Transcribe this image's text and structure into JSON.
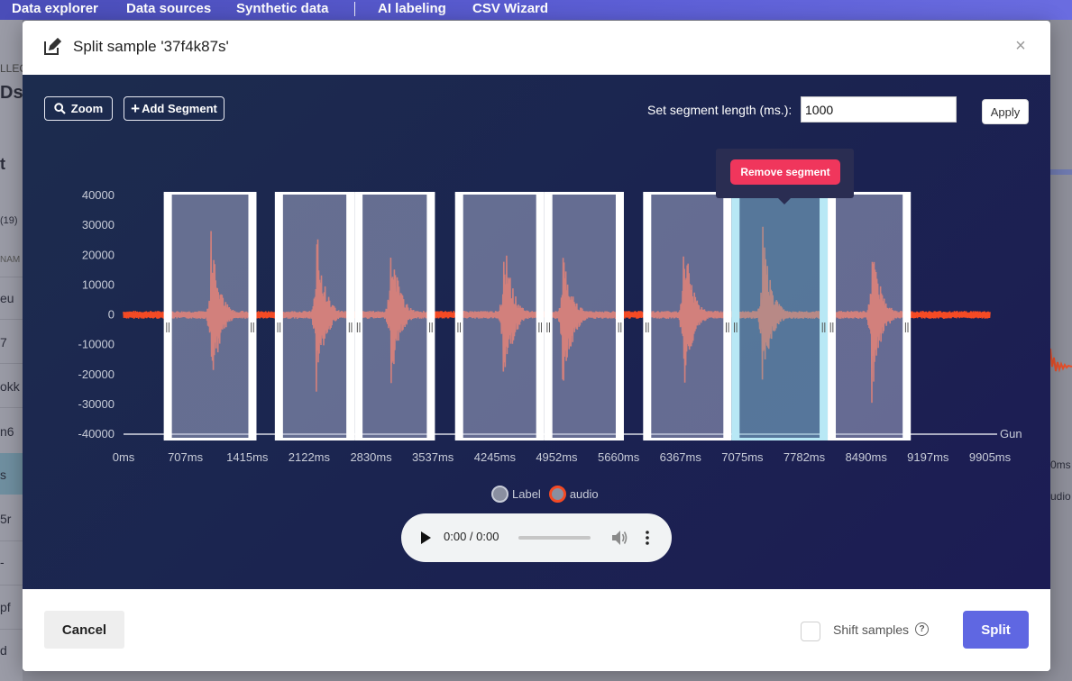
{
  "topnav": {
    "items": [
      "Data explorer",
      "Data sources",
      "Synthetic data",
      "AI labeling",
      "CSV Wizard"
    ]
  },
  "background_left": {
    "texts": [
      "LLEC",
      "Ds",
      "t",
      "(19)",
      "NAM",
      "eu",
      "7",
      "okk",
      "n6",
      "s",
      "5r",
      "-",
      "pf",
      "d"
    ]
  },
  "background_right": {
    "texts": [
      "0ms",
      "udio"
    ]
  },
  "modal": {
    "title": "Split sample '37f4k87s'",
    "close_symbol": "×",
    "icons": {
      "edit": "edit-icon",
      "close": "close-icon"
    }
  },
  "toolbar": {
    "zoom_label": "Zoom",
    "zoom_icon": "search-icon",
    "add_segment_label": "Add Segment",
    "add_icon": "+",
    "segment_length_label": "Set segment length (ms.):",
    "segment_length_value": "1000",
    "apply_label": "Apply"
  },
  "tooltip": {
    "remove_label": "Remove segment"
  },
  "legend": {
    "items": [
      {
        "name": "Label",
        "color": "#8a8fa0"
      },
      {
        "name": "audio",
        "color": "#f44a24"
      }
    ]
  },
  "audio_player": {
    "time": "0:00 / 0:00",
    "icons": [
      "play-icon",
      "volume-icon",
      "more-options-icon"
    ]
  },
  "footer": {
    "cancel_label": "Cancel",
    "shift_label": "Shift samples",
    "shift_checked": false,
    "help_symbol": "?",
    "split_label": "Split"
  },
  "chart_data": {
    "type": "line",
    "ylim": [
      -40000,
      40000
    ],
    "xlim": [
      0,
      9905
    ],
    "y_ticks": [
      40000,
      30000,
      20000,
      10000,
      0,
      -10000,
      -20000,
      -30000,
      -40000
    ],
    "x_ticks": [
      "0ms",
      "707ms",
      "1415ms",
      "2122ms",
      "2830ms",
      "3537ms",
      "4245ms",
      "4952ms",
      "5660ms",
      "6367ms",
      "7075ms",
      "7782ms",
      "8490ms",
      "9197ms",
      "9905ms"
    ],
    "x_tick_values": [
      0,
      707,
      1415,
      2122,
      2830,
      3537,
      4245,
      4952,
      5660,
      6367,
      7075,
      7782,
      8490,
      9197,
      9905
    ],
    "axis_end_label": "Gun",
    "series": [
      {
        "name": "audio",
        "color": "#f44a24"
      }
    ],
    "waveform": {
      "baseline_amplitude": 1200,
      "bursts": [
        {
          "center_ms": 1000,
          "peak_pos": 29000,
          "peak_neg": -32000
        },
        {
          "center_ms": 2200,
          "peak_pos": 32000,
          "peak_neg": -30000
        },
        {
          "center_ms": 3050,
          "peak_pos": 32000,
          "peak_neg": -27000
        },
        {
          "center_ms": 4340,
          "peak_pos": 31000,
          "peak_neg": -33000
        },
        {
          "center_ms": 5020,
          "peak_pos": 26000,
          "peak_neg": -33000
        },
        {
          "center_ms": 6400,
          "peak_pos": 32000,
          "peak_neg": -33000
        },
        {
          "center_ms": 7300,
          "peak_pos": 33000,
          "peak_neg": -30000
        },
        {
          "center_ms": 8550,
          "peak_pos": 32000,
          "peak_neg": -32000
        }
      ]
    },
    "segments": [
      {
        "start_ms": 460,
        "end_ms": 1520,
        "selected": false
      },
      {
        "start_ms": 1730,
        "end_ms": 2640,
        "selected": false
      },
      {
        "start_ms": 2640,
        "end_ms": 3560,
        "selected": false
      },
      {
        "start_ms": 3790,
        "end_ms": 4810,
        "selected": false
      },
      {
        "start_ms": 4810,
        "end_ms": 5720,
        "selected": false
      },
      {
        "start_ms": 5940,
        "end_ms": 6950,
        "selected": false
      },
      {
        "start_ms": 6950,
        "end_ms": 8050,
        "selected": true
      },
      {
        "start_ms": 8050,
        "end_ms": 9000,
        "selected": false
      }
    ]
  }
}
